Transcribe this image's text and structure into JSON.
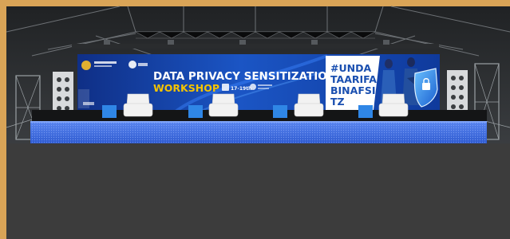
{
  "scene": {
    "frame_color": "#d9a457",
    "lower_panel_color": "#3c3c3c"
  },
  "banner": {
    "headline": "DATA PRIVACY SENSITIZATION",
    "subheadline": "WORKSHOP",
    "date_label": "17-19th",
    "hashtag_lines": [
      "#UNDA",
      "TAARIFA",
      "BINAFSI",
      "TZ"
    ],
    "accent_color": "#f5c400",
    "background_color": "#1547a8",
    "hashtag_panel_color": "#ffffff",
    "hashtag_text_color": "#1a4fb0"
  },
  "stage": {
    "armchair_count": 4,
    "side_table_count": 4,
    "armchair_color": "#f2f2f2",
    "side_table_color": "#2f86e6",
    "led_front_color": "#3d6de0"
  },
  "icons": [
    "shield-icon",
    "coat-of-arms-logo",
    "ministry-logo"
  ]
}
